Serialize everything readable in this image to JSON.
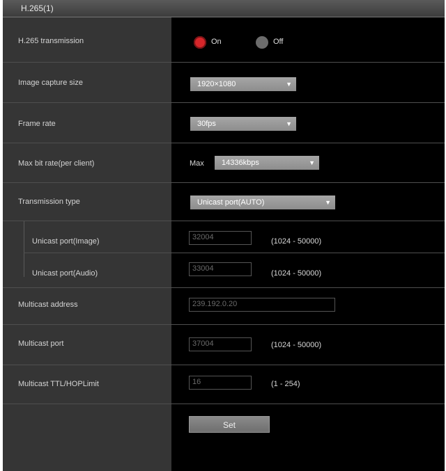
{
  "section": {
    "title": "H.265(1)"
  },
  "fields": {
    "h265_transmission": {
      "label": "H.265 transmission",
      "on_label": "On",
      "off_label": "Off",
      "selected": "On"
    },
    "image_capture_size": {
      "label": "Image capture size",
      "value": "1920×1080"
    },
    "frame_rate": {
      "label": "Frame rate",
      "value": "30fps"
    },
    "max_bit_rate": {
      "label": "Max bit rate(per client)",
      "prefix": "Max",
      "value": "14336kbps"
    },
    "transmission_type": {
      "label": "Transmission type",
      "value": "Unicast port(AUTO)"
    },
    "unicast_port_image": {
      "label": "Unicast port(Image)",
      "value": "32004",
      "range": "(1024 - 50000)"
    },
    "unicast_port_audio": {
      "label": "Unicast port(Audio)",
      "value": "33004",
      "range": "(1024 - 50000)"
    },
    "multicast_address": {
      "label": "Multicast address",
      "value": "239.192.0.20"
    },
    "multicast_port": {
      "label": "Multicast port",
      "value": "37004",
      "range": "(1024 - 50000)"
    },
    "multicast_ttl": {
      "label": "Multicast TTL/HOPLimit",
      "value": "16",
      "range": "(1 - 254)"
    }
  },
  "actions": {
    "set_label": "Set"
  },
  "colors": {
    "radio_on": "#d6262a",
    "radio_off": "#6c6c6c",
    "label_column": "#353535",
    "value_column": "#000000"
  }
}
